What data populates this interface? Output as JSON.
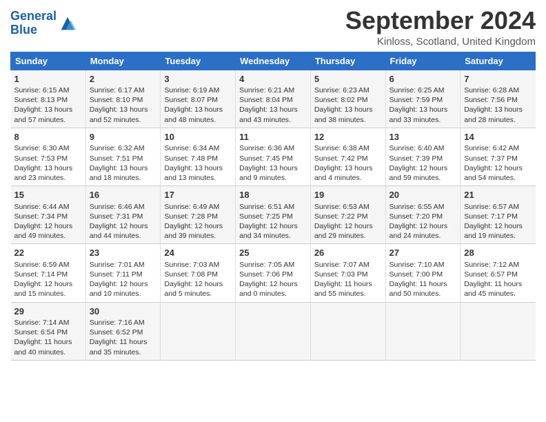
{
  "header": {
    "logo_line1": "General",
    "logo_line2": "Blue",
    "month": "September 2024",
    "location": "Kinloss, Scotland, United Kingdom"
  },
  "days_of_week": [
    "Sunday",
    "Monday",
    "Tuesday",
    "Wednesday",
    "Thursday",
    "Friday",
    "Saturday"
  ],
  "weeks": [
    [
      {
        "day": "1",
        "sunrise": "6:15 AM",
        "sunset": "8:13 PM",
        "daylight": "13 hours and 57 minutes."
      },
      {
        "day": "2",
        "sunrise": "6:17 AM",
        "sunset": "8:10 PM",
        "daylight": "13 hours and 52 minutes."
      },
      {
        "day": "3",
        "sunrise": "6:19 AM",
        "sunset": "8:07 PM",
        "daylight": "13 hours and 48 minutes."
      },
      {
        "day": "4",
        "sunrise": "6:21 AM",
        "sunset": "8:04 PM",
        "daylight": "13 hours and 43 minutes."
      },
      {
        "day": "5",
        "sunrise": "6:23 AM",
        "sunset": "8:02 PM",
        "daylight": "13 hours and 38 minutes."
      },
      {
        "day": "6",
        "sunrise": "6:25 AM",
        "sunset": "7:59 PM",
        "daylight": "13 hours and 33 minutes."
      },
      {
        "day": "7",
        "sunrise": "6:28 AM",
        "sunset": "7:56 PM",
        "daylight": "13 hours and 28 minutes."
      }
    ],
    [
      {
        "day": "8",
        "sunrise": "6:30 AM",
        "sunset": "7:53 PM",
        "daylight": "13 hours and 23 minutes."
      },
      {
        "day": "9",
        "sunrise": "6:32 AM",
        "sunset": "7:51 PM",
        "daylight": "13 hours and 18 minutes."
      },
      {
        "day": "10",
        "sunrise": "6:34 AM",
        "sunset": "7:48 PM",
        "daylight": "13 hours and 13 minutes."
      },
      {
        "day": "11",
        "sunrise": "6:36 AM",
        "sunset": "7:45 PM",
        "daylight": "13 hours and 9 minutes."
      },
      {
        "day": "12",
        "sunrise": "6:38 AM",
        "sunset": "7:42 PM",
        "daylight": "13 hours and 4 minutes."
      },
      {
        "day": "13",
        "sunrise": "6:40 AM",
        "sunset": "7:39 PM",
        "daylight": "12 hours and 59 minutes."
      },
      {
        "day": "14",
        "sunrise": "6:42 AM",
        "sunset": "7:37 PM",
        "daylight": "12 hours and 54 minutes."
      }
    ],
    [
      {
        "day": "15",
        "sunrise": "6:44 AM",
        "sunset": "7:34 PM",
        "daylight": "12 hours and 49 minutes."
      },
      {
        "day": "16",
        "sunrise": "6:46 AM",
        "sunset": "7:31 PM",
        "daylight": "12 hours and 44 minutes."
      },
      {
        "day": "17",
        "sunrise": "6:49 AM",
        "sunset": "7:28 PM",
        "daylight": "12 hours and 39 minutes."
      },
      {
        "day": "18",
        "sunrise": "6:51 AM",
        "sunset": "7:25 PM",
        "daylight": "12 hours and 34 minutes."
      },
      {
        "day": "19",
        "sunrise": "6:53 AM",
        "sunset": "7:22 PM",
        "daylight": "12 hours and 29 minutes."
      },
      {
        "day": "20",
        "sunrise": "6:55 AM",
        "sunset": "7:20 PM",
        "daylight": "12 hours and 24 minutes."
      },
      {
        "day": "21",
        "sunrise": "6:57 AM",
        "sunset": "7:17 PM",
        "daylight": "12 hours and 19 minutes."
      }
    ],
    [
      {
        "day": "22",
        "sunrise": "6:59 AM",
        "sunset": "7:14 PM",
        "daylight": "12 hours and 15 minutes."
      },
      {
        "day": "23",
        "sunrise": "7:01 AM",
        "sunset": "7:11 PM",
        "daylight": "12 hours and 10 minutes."
      },
      {
        "day": "24",
        "sunrise": "7:03 AM",
        "sunset": "7:08 PM",
        "daylight": "12 hours and 5 minutes."
      },
      {
        "day": "25",
        "sunrise": "7:05 AM",
        "sunset": "7:06 PM",
        "daylight": "12 hours and 0 minutes."
      },
      {
        "day": "26",
        "sunrise": "7:07 AM",
        "sunset": "7:03 PM",
        "daylight": "11 hours and 55 minutes."
      },
      {
        "day": "27",
        "sunrise": "7:10 AM",
        "sunset": "7:00 PM",
        "daylight": "11 hours and 50 minutes."
      },
      {
        "day": "28",
        "sunrise": "7:12 AM",
        "sunset": "6:57 PM",
        "daylight": "11 hours and 45 minutes."
      }
    ],
    [
      {
        "day": "29",
        "sunrise": "7:14 AM",
        "sunset": "6:54 PM",
        "daylight": "11 hours and 40 minutes."
      },
      {
        "day": "30",
        "sunrise": "7:16 AM",
        "sunset": "6:52 PM",
        "daylight": "11 hours and 35 minutes."
      },
      null,
      null,
      null,
      null,
      null
    ]
  ]
}
